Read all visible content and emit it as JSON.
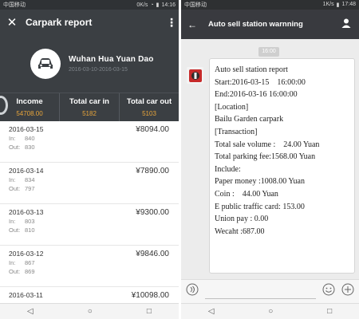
{
  "left": {
    "status": {
      "carrier": "中国移动",
      "speed": "0K/s",
      "time": "14:16"
    },
    "toolbar": {
      "title": "Carpark report"
    },
    "hero": {
      "name": "Wuhan Hua Yuan Dao",
      "range": "2016-03-10-2016-03-15"
    },
    "stats": [
      {
        "label": "Income",
        "value": "54708.00"
      },
      {
        "label": "Total car in",
        "value": "5182"
      },
      {
        "label": "Total car out",
        "value": "5103"
      }
    ],
    "rows": [
      {
        "date": "2016-03-15",
        "amount": "¥8094.00",
        "in_label": "In:",
        "in": "840",
        "out_label": "Out:",
        "out": "830"
      },
      {
        "date": "2016-03-14",
        "amount": "¥7890.00",
        "in_label": "In:",
        "in": "834",
        "out_label": "Out:",
        "out": "797"
      },
      {
        "date": "2016-03-13",
        "amount": "¥9300.00",
        "in_label": "In:",
        "in": "803",
        "out_label": "Out:",
        "out": "810"
      },
      {
        "date": "2016-03-12",
        "amount": "¥9846.00",
        "in_label": "In:",
        "in": "867",
        "out_label": "Out:",
        "out": "869"
      },
      {
        "date": "2016-03-11",
        "amount": "¥10098.00",
        "in_label": "",
        "in": "",
        "out_label": "",
        "out": ""
      }
    ]
  },
  "right": {
    "status": {
      "carrier": "中国移动",
      "speed": "1K/s",
      "time": "17:48"
    },
    "toolbar": {
      "title": "Auto sell station warnning"
    },
    "time_pill": "16:00",
    "message": {
      "lines": [
        "Auto sell station report",
        "Start:2016-03-15    16:00:00",
        "End:2016-03-16 16:00:00",
        "",
        "[Location]",
        "Bailu Garden carpark",
        "",
        "[Transaction]",
        "Total sale volume :    24.00 Yuan",
        "Total parking fee:1568.00 Yuan",
        "Include:",
        "Paper money :1008.00 Yuan",
        "Coin :    44.00 Yuan",
        "E public traffic card: 153.00",
        "Union pay : 0.00",
        "Wecaht :687.00"
      ]
    }
  },
  "colors": {
    "dark_header": "#3b3f43",
    "accent_value": "#e8a53a"
  }
}
